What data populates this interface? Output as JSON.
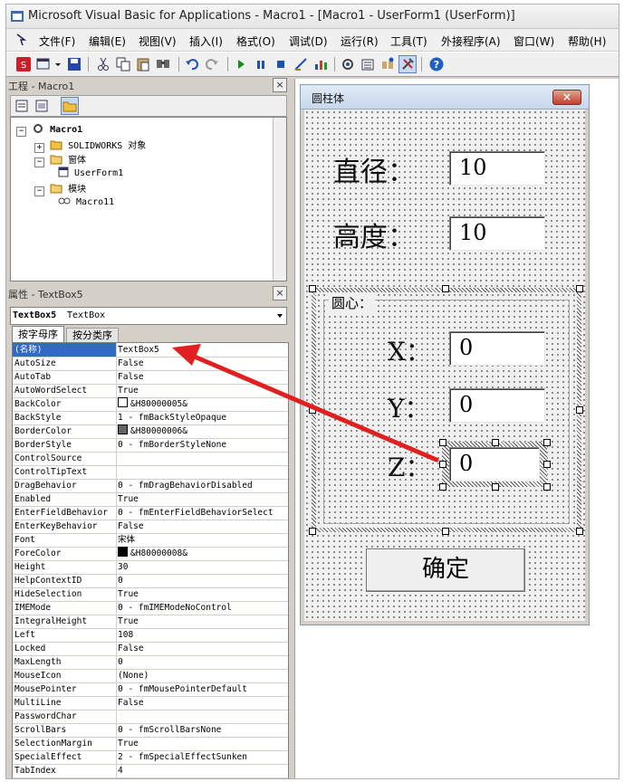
{
  "window": {
    "title": "Microsoft Visual Basic for Applications - Macro1 - [Macro1 - UserForm1 (UserForm)]"
  },
  "menu": [
    "文件(F)",
    "编辑(E)",
    "视图(V)",
    "插入(I)",
    "格式(O)",
    "调试(D)",
    "运行(R)",
    "工具(T)",
    "外接程序(A)",
    "窗口(W)",
    "帮助(H)"
  ],
  "project": {
    "title": "工程 - Macro1",
    "close": "×",
    "root": "Macro1",
    "nodes": [
      "SOLIDWORKS 对象",
      "窗体",
      "UserForm1",
      "模块",
      "Macro11"
    ]
  },
  "properties": {
    "title": "属性 - TextBox5",
    "close": "×",
    "object_name": "TextBox5",
    "object_type": "TextBox",
    "tabs": [
      "按字母序",
      "按分类序"
    ],
    "rows": [
      {
        "name": "(名称)",
        "value": "TextBox5"
      },
      {
        "name": "AutoSize",
        "value": "False"
      },
      {
        "name": "AutoTab",
        "value": "False"
      },
      {
        "name": "AutoWordSelect",
        "value": "True"
      },
      {
        "name": "BackColor",
        "value": "&H80000005&",
        "swatch": "#ffffff"
      },
      {
        "name": "BackStyle",
        "value": "1 - fmBackStyleOpaque"
      },
      {
        "name": "BorderColor",
        "value": "&H80000006&",
        "swatch": "#646464"
      },
      {
        "name": "BorderStyle",
        "value": "0 - fmBorderStyleNone"
      },
      {
        "name": "ControlSource",
        "value": ""
      },
      {
        "name": "ControlTipText",
        "value": ""
      },
      {
        "name": "DragBehavior",
        "value": "0 - fmDragBehaviorDisabled"
      },
      {
        "name": "Enabled",
        "value": "True"
      },
      {
        "name": "EnterFieldBehavior",
        "value": "0 - fmEnterFieldBehaviorSelect"
      },
      {
        "name": "EnterKeyBehavior",
        "value": "False"
      },
      {
        "name": "Font",
        "value": "宋体"
      },
      {
        "name": "ForeColor",
        "value": "&H80000008&",
        "swatch": "#000000"
      },
      {
        "name": "Height",
        "value": "30"
      },
      {
        "name": "HelpContextID",
        "value": "0"
      },
      {
        "name": "HideSelection",
        "value": "True"
      },
      {
        "name": "IMEMode",
        "value": "0 - fmIMEModeNoControl"
      },
      {
        "name": "IntegralHeight",
        "value": "True"
      },
      {
        "name": "Left",
        "value": "108"
      },
      {
        "name": "Locked",
        "value": "False"
      },
      {
        "name": "MaxLength",
        "value": "0"
      },
      {
        "name": "MouseIcon",
        "value": "(None)"
      },
      {
        "name": "MousePointer",
        "value": "0 - fmMousePointerDefault"
      },
      {
        "name": "MultiLine",
        "value": "False"
      },
      {
        "name": "PasswordChar",
        "value": ""
      },
      {
        "name": "ScrollBars",
        "value": "0 - fmScrollBarsNone"
      },
      {
        "name": "SelectionMargin",
        "value": "True"
      },
      {
        "name": "SpecialEffect",
        "value": "2 - fmSpecialEffectSunken"
      },
      {
        "name": "TabIndex",
        "value": "4"
      }
    ]
  },
  "form": {
    "title": "圆柱体",
    "close": "×",
    "diameter_label": "直径：",
    "diameter_value": "10",
    "height_label": "高度：",
    "height_value": "10",
    "frame_label": "圆心：",
    "x_label": "X：",
    "x_value": "0",
    "y_label": "Y：",
    "y_value": "0",
    "z_label": "Z：",
    "z_value": "0",
    "ok_button": "确定"
  },
  "colors": {
    "arrow": "#e02020",
    "selected_row": "#316ac5"
  }
}
